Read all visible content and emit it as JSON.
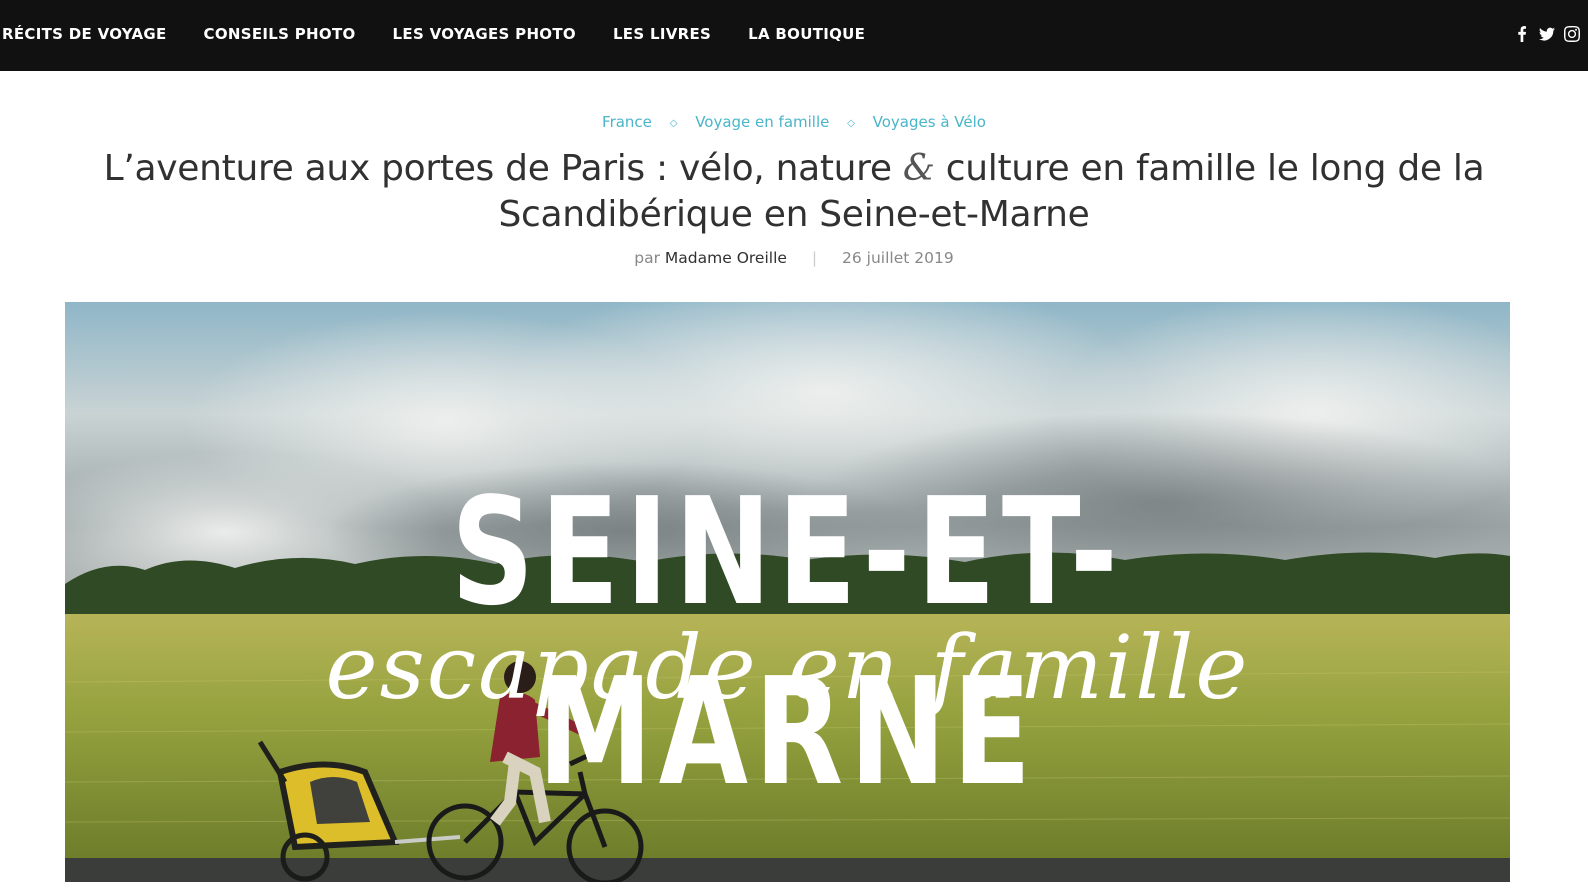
{
  "nav": {
    "items": [
      "RÉCITS DE VOYAGE",
      "CONSEILS PHOTO",
      "LES VOYAGES PHOTO",
      "LES LIVRES",
      "LA BOUTIQUE"
    ],
    "social": [
      "facebook-icon",
      "twitter-icon",
      "instagram-icon"
    ],
    "background": "#111111"
  },
  "post": {
    "categories": [
      "France",
      "Voyage en famille",
      "Voyages à Vélo"
    ],
    "title_part1": "L’aventure aux portes de Paris : vélo, nature ",
    "title_amp": "&",
    "title_part2": " culture en famille le long de la Scandibérique en Seine-et-Marne",
    "meta_prefix": "par",
    "author": "Madame Oreille",
    "meta_separator": "|",
    "date": "26 juillet 2019",
    "accent_color": "#4ab5c9"
  },
  "hero": {
    "title": "SEINE-ET-MARNE",
    "script": "escapade en famille"
  }
}
